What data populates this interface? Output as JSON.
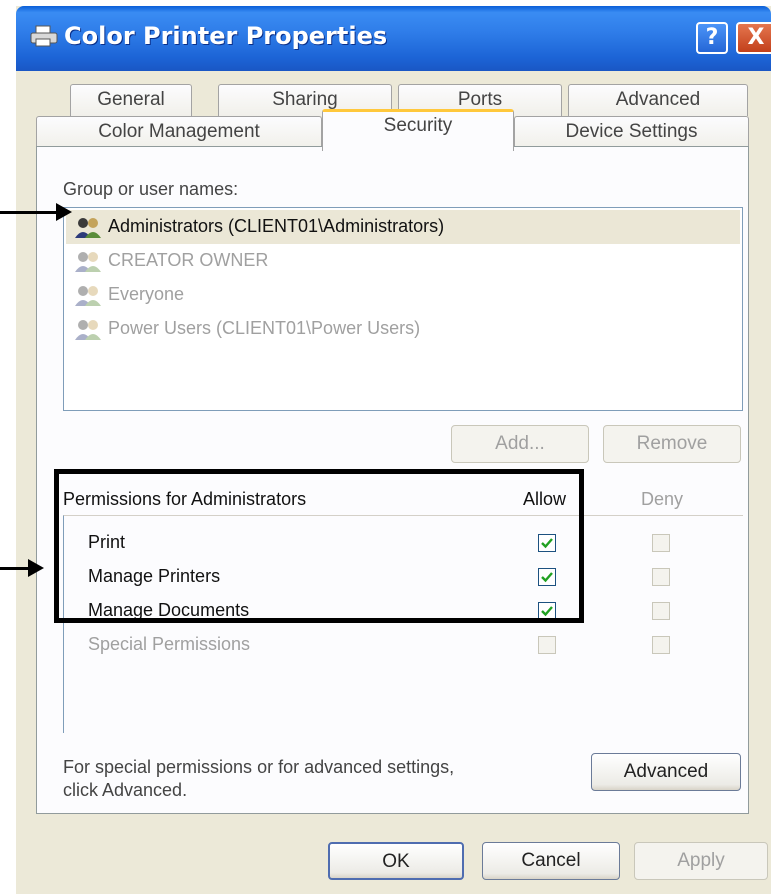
{
  "window": {
    "title": "Color Printer Properties",
    "help_label": "?",
    "close_label": "X"
  },
  "tabs_row1": [
    "General",
    "Sharing",
    "Ports",
    "Advanced"
  ],
  "tabs_row2": [
    "Color Management",
    "Security",
    "Device Settings"
  ],
  "active_tab": "Security",
  "security": {
    "group_label": "Group or user names:",
    "users": [
      {
        "name": "Administrators (CLIENT01\\Administrators)",
        "selected": true
      },
      {
        "name": "CREATOR OWNER",
        "selected": false
      },
      {
        "name": "Everyone",
        "selected": false
      },
      {
        "name": "Power Users (CLIENT01\\Power Users)",
        "selected": false
      }
    ],
    "add_label": "Add...",
    "remove_label": "Remove",
    "permissions_label": "Permissions for Administrators",
    "allow_label": "Allow",
    "deny_label": "Deny",
    "permissions": [
      {
        "name": "Print",
        "allow": true,
        "deny": false,
        "enabled": true
      },
      {
        "name": "Manage Printers",
        "allow": true,
        "deny": false,
        "enabled": true
      },
      {
        "name": "Manage Documents",
        "allow": true,
        "deny": false,
        "enabled": true
      },
      {
        "name": "Special Permissions",
        "allow": false,
        "deny": false,
        "enabled": false
      }
    ],
    "advanced_hint_line1": "For special permissions or for advanced settings,",
    "advanced_hint_line2": "click Advanced.",
    "advanced_label": "Advanced"
  },
  "footer": {
    "ok_label": "OK",
    "cancel_label": "Cancel",
    "apply_label": "Apply"
  },
  "colors": {
    "titlebar": "#2f7de9",
    "dialog_bg": "#ece9d8",
    "selection": "#ebe7d6",
    "check": "#21a121",
    "tab_highlight": "#ffc83c"
  },
  "icons": {
    "title": "printer-icon",
    "user": "user-group-icon",
    "checkbox": "checkmark-icon"
  }
}
